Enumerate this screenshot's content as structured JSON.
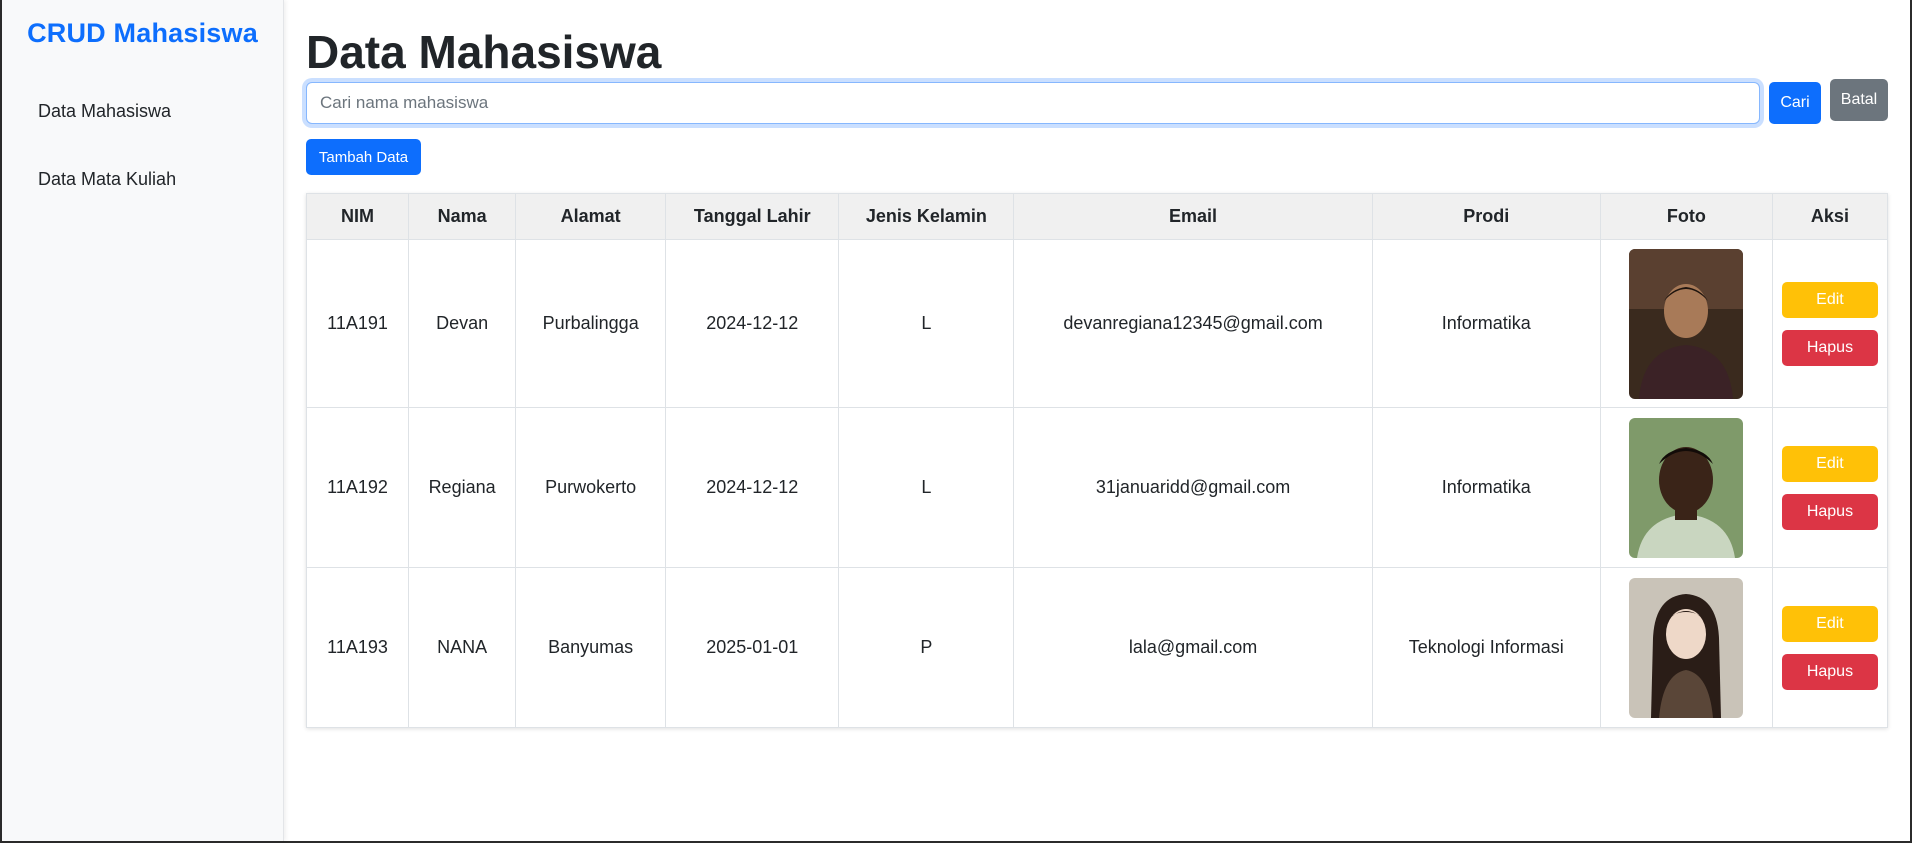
{
  "sidebar": {
    "brand": "CRUD Mahasiswa",
    "items": [
      {
        "label": "Data Mahasiswa"
      },
      {
        "label": "Data Mata Kuliah"
      }
    ]
  },
  "main": {
    "title": "Data Mahasiswa",
    "search": {
      "placeholder": "Cari nama mahasiswa",
      "value": ""
    },
    "search_button": "Cari",
    "cancel_button": "Batal",
    "add_button": "Tambah Data"
  },
  "table": {
    "columns": [
      "NIM",
      "Nama",
      "Alamat",
      "Tanggal Lahir",
      "Jenis Kelamin",
      "Email",
      "Prodi",
      "Foto",
      "Aksi"
    ],
    "edit_label": "Edit",
    "delete_label": "Hapus",
    "rows": [
      {
        "nim": "11A191",
        "nama": "Devan",
        "alamat": "Purbalingga",
        "tanggal_lahir": "2024-12-12",
        "jenis_kelamin": "L",
        "email": "devanregiana12345@gmail.com",
        "prodi": "Informatika",
        "foto": "student-photo-devan"
      },
      {
        "nim": "11A192",
        "nama": "Regiana",
        "alamat": "Purwokerto",
        "tanggal_lahir": "2024-12-12",
        "jenis_kelamin": "L",
        "email": "31januaridd@gmail.com",
        "prodi": "Informatika",
        "foto": "student-photo-regiana"
      },
      {
        "nim": "11A193",
        "nama": "NANA",
        "alamat": "Banyumas",
        "tanggal_lahir": "2025-01-01",
        "jenis_kelamin": "P",
        "email": "lala@gmail.com",
        "prodi": "Teknologi Informasi",
        "foto": "student-photo-nana"
      }
    ]
  },
  "colors": {
    "brand": "#0d6efd",
    "primary": "#0d6efd",
    "secondary": "#6c757d",
    "warning": "#ffc107",
    "danger": "#dc3545"
  }
}
